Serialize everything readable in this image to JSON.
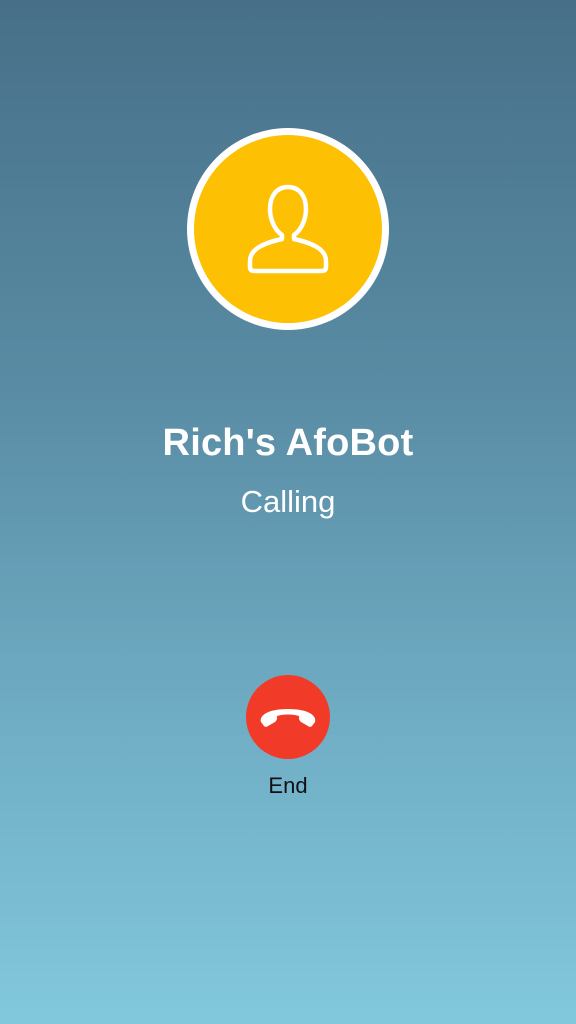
{
  "call": {
    "caller_name": "Rich's AfoBot",
    "status": "Calling"
  },
  "actions": {
    "end_label": "End"
  },
  "icons": {
    "avatar": "person-icon",
    "end": "phone-hangup-icon"
  },
  "colors": {
    "avatar_background": "#fec002",
    "end_button": "#f23a28",
    "gradient_top": "#476f88",
    "gradient_bottom": "#82c8dc"
  }
}
